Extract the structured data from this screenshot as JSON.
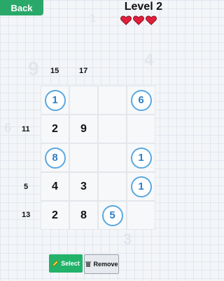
{
  "header": {
    "back_label": "Back",
    "level_label": "Level 2",
    "lives": 3
  },
  "columns": {
    "clues": [
      "15",
      "17"
    ]
  },
  "rows": {
    "clues": [
      "",
      "11",
      "",
      "5",
      "13"
    ]
  },
  "board": {
    "rows": [
      [
        {
          "v": "1",
          "c": true
        },
        {
          "v": "",
          "c": false
        },
        {
          "v": "",
          "c": false
        },
        {
          "v": "6",
          "c": true
        }
      ],
      [
        {
          "v": "2",
          "c": false
        },
        {
          "v": "9",
          "c": false
        },
        {
          "v": "",
          "c": false
        },
        {
          "v": "",
          "c": false
        }
      ],
      [
        {
          "v": "8",
          "c": true
        },
        {
          "v": "",
          "c": false
        },
        {
          "v": "",
          "c": false
        },
        {
          "v": "1",
          "c": true
        }
      ],
      [
        {
          "v": "4",
          "c": false
        },
        {
          "v": "3",
          "c": false
        },
        {
          "v": "",
          "c": false
        },
        {
          "v": "1",
          "c": true
        }
      ],
      [
        {
          "v": "2",
          "c": false
        },
        {
          "v": "8",
          "c": false
        },
        {
          "v": "5",
          "c": true
        },
        {
          "v": "",
          "c": false
        }
      ]
    ]
  },
  "toolbar": {
    "select_label": "Select",
    "remove_label": "Remove"
  },
  "colors": {
    "primary": "#2aa86a",
    "circle": "#5aa8e0",
    "heart": "#e0203a"
  }
}
